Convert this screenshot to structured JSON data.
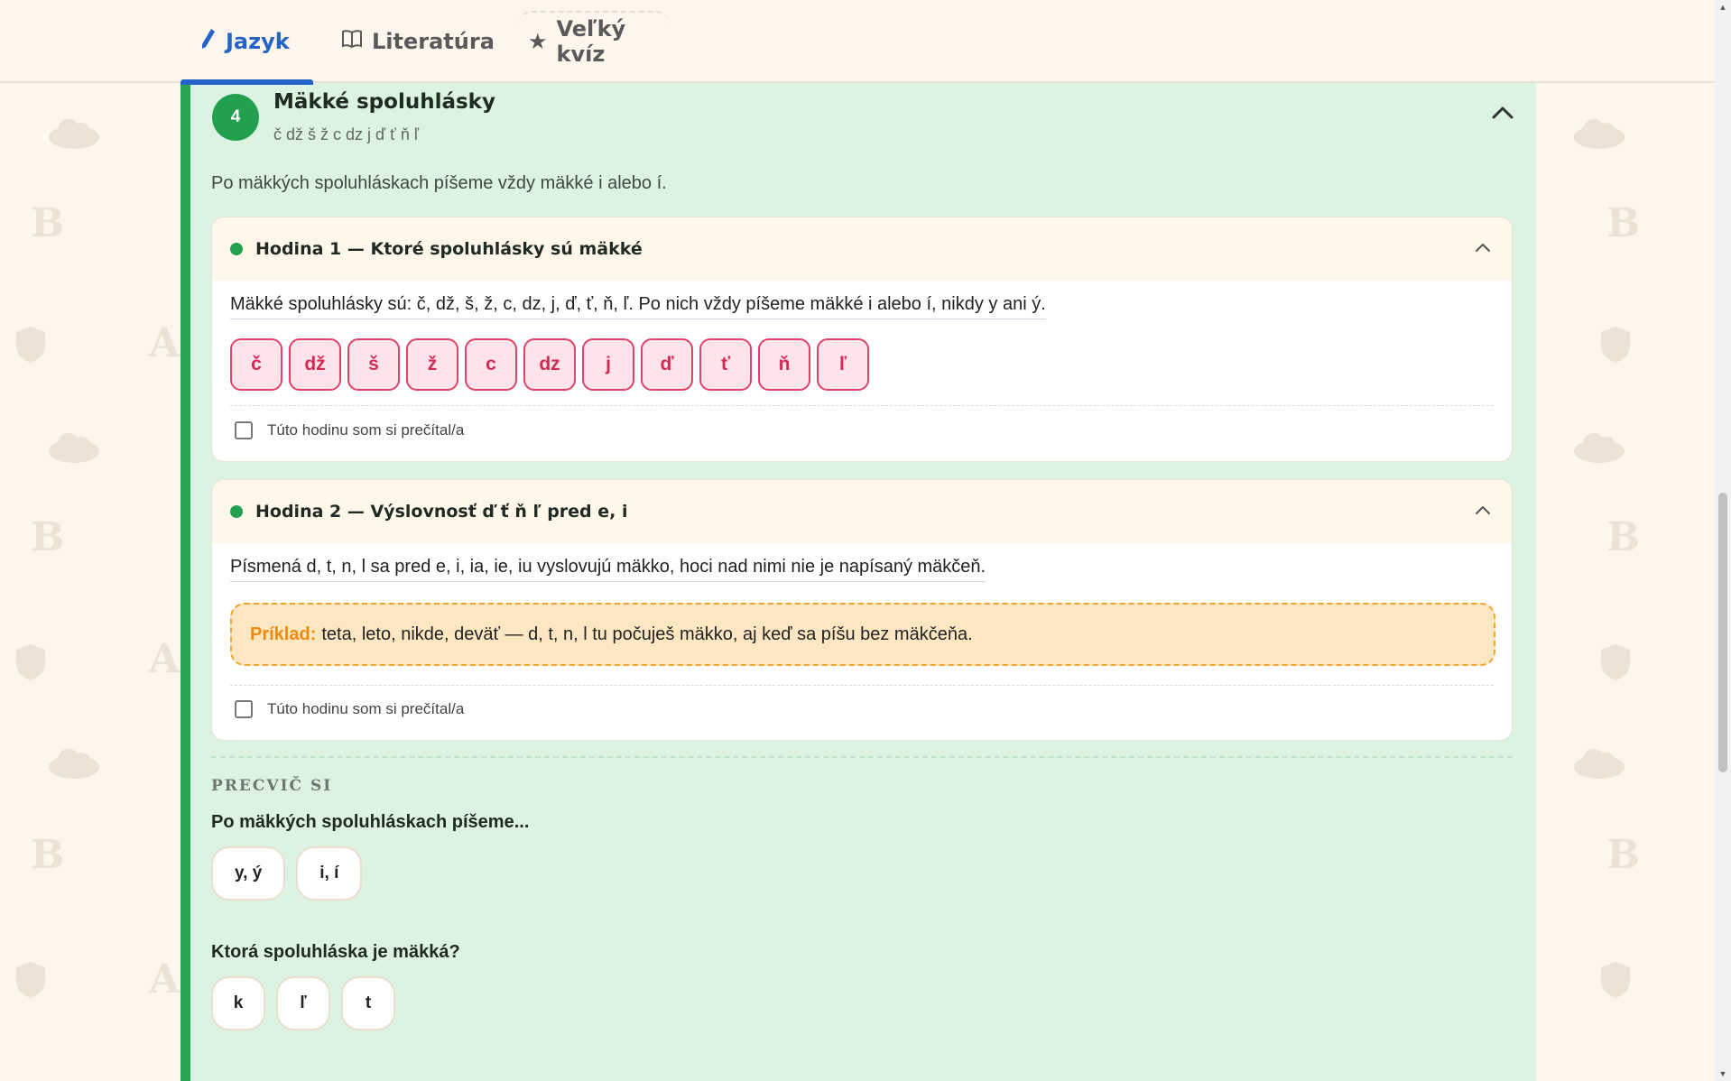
{
  "tabs": [
    {
      "label": "Jazyk",
      "icon": "pencil-icon",
      "active": true
    },
    {
      "label": "Literatúra",
      "icon": "book-icon",
      "active": false
    },
    {
      "label": "Veľký kvíz",
      "icon": "star-icon",
      "active": false
    }
  ],
  "lesson": {
    "number": "4",
    "title": "Mäkké spoluhlásky",
    "subtitle": "č dž š ž c dz j ď ť ň ľ",
    "description": "Po mäkkých spoluhláskach píšeme vždy mäkké i alebo í."
  },
  "hours": [
    {
      "title": "Hodina 1 — Ktoré spoluhlásky sú mäkké",
      "text": "Mäkké spoluhlásky sú: č, dž, š, ž, c, dz, j, ď, ť, ň, ľ. Po nich vždy píšeme mäkké i alebo í, nikdy y ani ý.",
      "letters": [
        "č",
        "dž",
        "š",
        "ž",
        "c",
        "dz",
        "j",
        "ď",
        "ť",
        "ň",
        "ľ"
      ],
      "read_label": "Túto hodinu som si prečítal/a"
    },
    {
      "title": "Hodina 2 — Výslovnosť ď ť ň ľ pred e, i",
      "text": "Písmená d, t, n, l sa pred e, i, ia, ie, iu vyslovujú mäkko, hoci nad nimi nie je napísaný mäkčeň.",
      "example_label": "Príklad:",
      "example_text": "teta, leto, nikde, deväť — d, t, n, l tu počuješ mäkko, aj keď sa píšu bez mäkčeňa.",
      "read_label": "Túto hodinu som si prečítal/a"
    }
  ],
  "practice": {
    "heading": "PRECVIČ SI",
    "questions": [
      {
        "question": "Po mäkkých spoluhláskach píšeme...",
        "options": [
          "y, ý",
          "i, í"
        ]
      },
      {
        "question": "Ktorá spoluhláska je mäkká?",
        "options": [
          "k",
          "ľ",
          "t"
        ]
      }
    ]
  },
  "colors": {
    "accent": "#2463c7",
    "lesson_bg": "#dcf3e2",
    "lesson_border": "#29a454",
    "letter_border": "#e0426a",
    "example_border": "#f2a52a"
  }
}
